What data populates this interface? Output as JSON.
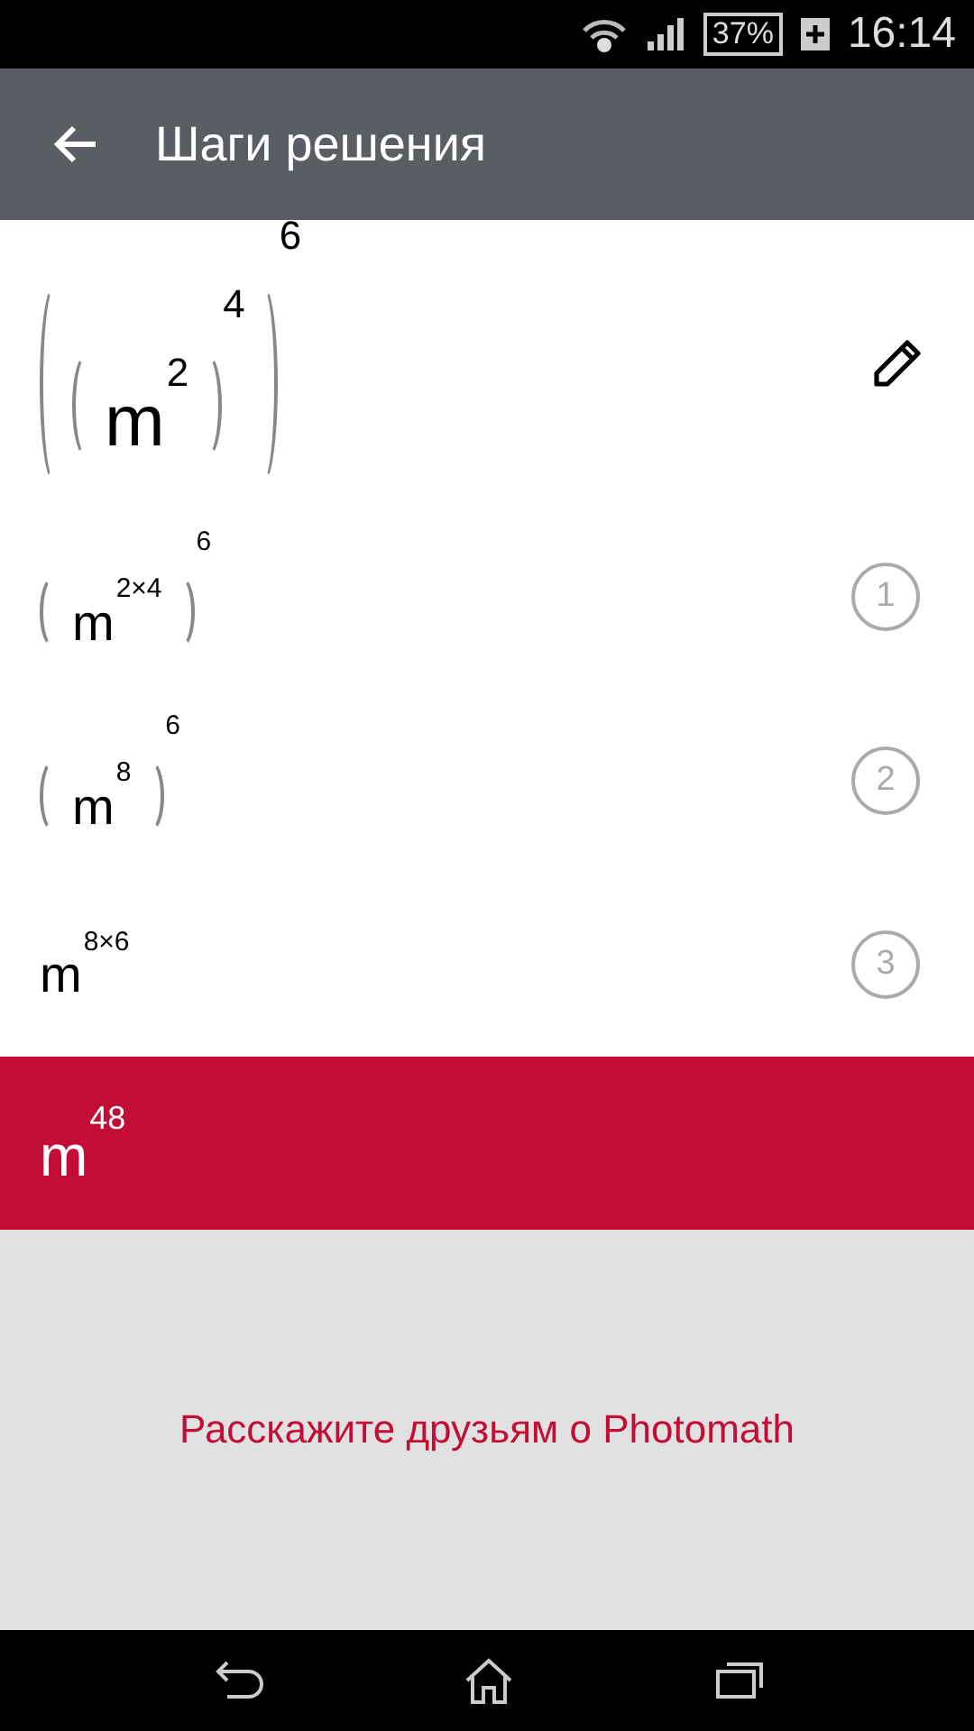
{
  "status_bar": {
    "battery": "37%",
    "time": "16:14"
  },
  "app_bar": {
    "title": "Шаги решения"
  },
  "problem": {
    "kind": "power",
    "paren": true,
    "exp": "6",
    "base": {
      "kind": "power",
      "paren": true,
      "exp": "4",
      "base": {
        "kind": "power",
        "paren": false,
        "exp": "2",
        "base": {
          "kind": "var",
          "text": "m"
        }
      }
    }
  },
  "steps": [
    {
      "number": "1",
      "expression": {
        "kind": "power",
        "paren": true,
        "exp": "6",
        "base": {
          "kind": "power",
          "paren": false,
          "exp": "2×4",
          "base": {
            "kind": "var",
            "text": "m"
          }
        }
      }
    },
    {
      "number": "2",
      "expression": {
        "kind": "power",
        "paren": true,
        "exp": "6",
        "base": {
          "kind": "power",
          "paren": false,
          "exp": "8",
          "base": {
            "kind": "var",
            "text": "m"
          }
        }
      }
    },
    {
      "number": "3",
      "expression": {
        "kind": "power",
        "paren": false,
        "exp": "8×6",
        "base": {
          "kind": "var",
          "text": "m"
        }
      }
    }
  ],
  "result": {
    "kind": "power",
    "paren": false,
    "exp": "48",
    "base": {
      "kind": "var",
      "text": "m"
    }
  },
  "share_link": "Расскажите друзьям о Photomath"
}
